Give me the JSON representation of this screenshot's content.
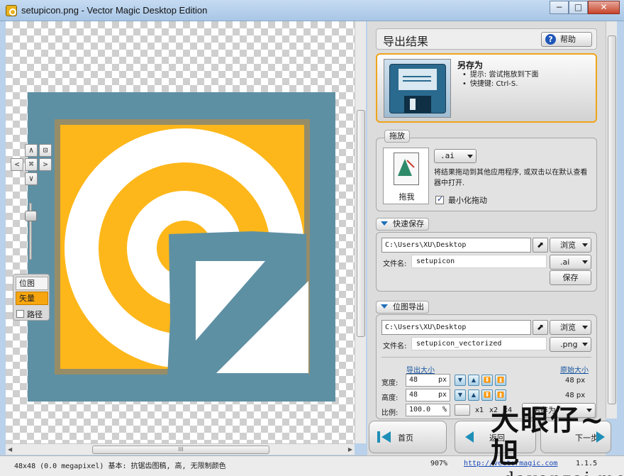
{
  "window": {
    "title": "setupicon.png - Vector Magic Desktop Edition",
    "minimize": "−",
    "maximize": "□",
    "close": "✕"
  },
  "canvas": {
    "nav": {
      "up": "∧",
      "down": "∨",
      "left": "<",
      "right": ">",
      "fit": "⌘",
      "center": "⊡"
    },
    "modes": {
      "bitmap": "位图",
      "vector": "矢量",
      "path": "路径"
    },
    "hscroll_grip": "III"
  },
  "status": {
    "info": "48x48 (0.0 megapixel)  基本: 抗锯齿图稿, 高, 无限制颜色",
    "zoom": "907%",
    "link": "http://vectormagic.com",
    "version": "1.1.5"
  },
  "panel": {
    "title": "导出结果",
    "help": "帮助",
    "save_as": {
      "title": "另存为",
      "tips": [
        "提示: 尝试拖放到下面",
        "快捷键: Ctrl-S."
      ]
    },
    "drag": {
      "tag": "拖放",
      "card_label": "拖我",
      "format": ".ai",
      "description": "将结果拖动到其他应用程序, 或双击以在默认查看器中打开.",
      "minimize_label": "最小化拖动"
    },
    "quick_save": {
      "tag": "快速保存",
      "path": "C:\\Users\\XU\\Desktop",
      "browse": "浏览",
      "filename_label": "文件名:",
      "filename": "setupicon",
      "format": ".ai",
      "save": "保存"
    },
    "bitmap_export": {
      "tag": "位图导出",
      "path": "C:\\Users\\XU\\Desktop",
      "browse": "浏览",
      "filename_label": "文件名:",
      "filename": "setupicon_vectorized",
      "format": ".png",
      "export_size_label": "导出大小",
      "original_size_label": "原始大小",
      "width_label": "宽度:",
      "height_label": "高度:",
      "ratio_label": "比例:",
      "width": "48",
      "height": "48",
      "ratio": "100.0",
      "unit_px": "px",
      "unit_pct": "%",
      "original_width": "48 px",
      "original_height": "48 px",
      "x1": "x1",
      "x2": "x2",
      "x4": "x4",
      "save_as": "另存为"
    },
    "bottom": {
      "home": "首页",
      "back": "返回",
      "next": "下一步"
    }
  },
  "watermark": {
    "text": "大眼仔~旭",
    "sub": "dayanzai.me"
  },
  "colors": {
    "accent_orange": "#f7a610",
    "logo_teal": "#5e90a4",
    "logo_yellow": "#fdb71a",
    "card_border": "#f0a418"
  }
}
